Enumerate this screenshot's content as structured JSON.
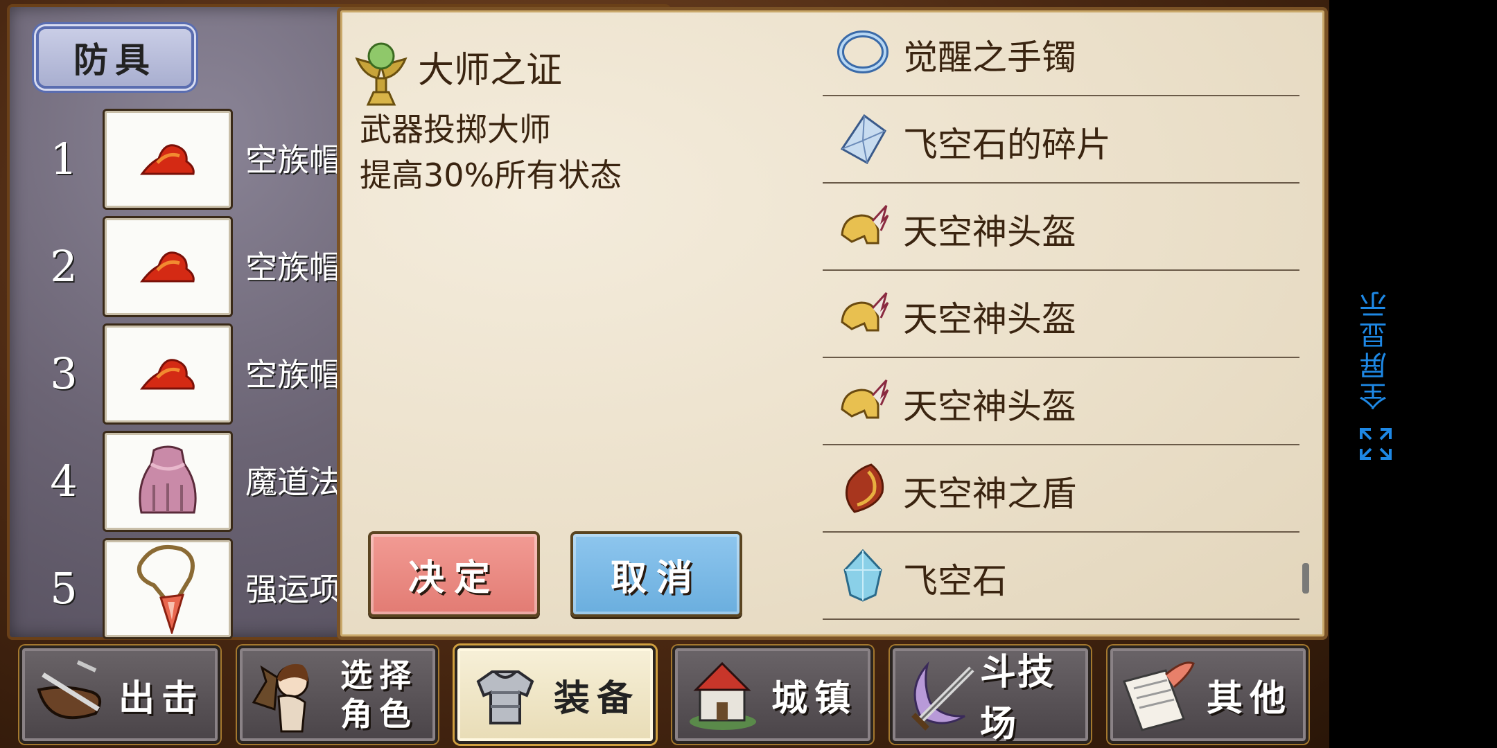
{
  "left_panel": {
    "title": "防具",
    "slots": [
      {
        "num": "1",
        "name": "空族帽"
      },
      {
        "num": "2",
        "name": "空族帽"
      },
      {
        "num": "3",
        "name": "空族帽"
      },
      {
        "num": "4",
        "name": "魔道法"
      },
      {
        "num": "5",
        "name": "强运项"
      }
    ]
  },
  "dialog": {
    "item_title": "大师之证",
    "desc_line1": "武器投掷大师",
    "desc_line2": "提高30%所有状态",
    "confirm_label": "决定",
    "cancel_label": "取消",
    "list": [
      {
        "label": "觉醒之手镯",
        "icon": "bracelet-icon"
      },
      {
        "label": "飞空石的碎片",
        "icon": "crystal-shard-icon"
      },
      {
        "label": "天空神头盔",
        "icon": "winged-helmet-icon"
      },
      {
        "label": "天空神头盔",
        "icon": "winged-helmet-icon"
      },
      {
        "label": "天空神头盔",
        "icon": "winged-helmet-icon"
      },
      {
        "label": "天空神之盾",
        "icon": "shield-icon"
      },
      {
        "label": "飞空石",
        "icon": "crystal-icon"
      }
    ]
  },
  "nav": {
    "sortie": "出击",
    "select_line1": "选择",
    "select_line2": "角色",
    "equip": "装备",
    "town": "城镇",
    "arena": "斗技场",
    "other": "其他"
  },
  "side": {
    "fullscreen": "全屏显示"
  }
}
